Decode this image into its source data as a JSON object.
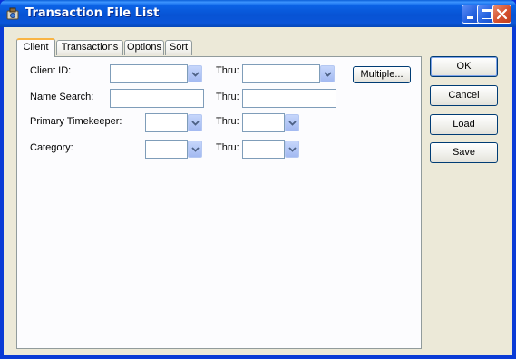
{
  "window": {
    "title": "Transaction File List"
  },
  "tabs": [
    {
      "label": "Client",
      "active": true
    },
    {
      "label": "Transactions",
      "active": false
    },
    {
      "label": "Options",
      "active": false
    },
    {
      "label": "Sort",
      "active": false
    }
  ],
  "form": {
    "client_id_label": "Client ID:",
    "client_id_value": "",
    "client_thru_label": "Thru:",
    "client_thru_value": "",
    "multiple_button": "Multiple...",
    "name_search_label": "Name Search:",
    "name_search_value": "",
    "name_thru_label": "Thru:",
    "name_thru_value": "",
    "primary_timekeeper_label": "Primary Timekeeper:",
    "primary_timekeeper_value": "",
    "timekeeper_thru_label": "Thru:",
    "timekeeper_thru_value": "",
    "category_label": "Category:",
    "category_value": "",
    "category_thru_label": "Thru:",
    "category_thru_value": ""
  },
  "actions": {
    "ok": "OK",
    "cancel": "Cancel",
    "load": "Load",
    "save": "Save"
  },
  "icons": {
    "app": "app-icon",
    "minimize": "minimize-icon",
    "maximize": "maximize-icon",
    "close": "close-icon",
    "dropdown": "chevron-down-icon"
  },
  "colors": {
    "titlebar": "#0753d4",
    "window_bg": "#ece9d8",
    "panel_bg": "#fcfcfe",
    "active_tab_accent": "#f9b443",
    "close_button": "#d5502e"
  }
}
